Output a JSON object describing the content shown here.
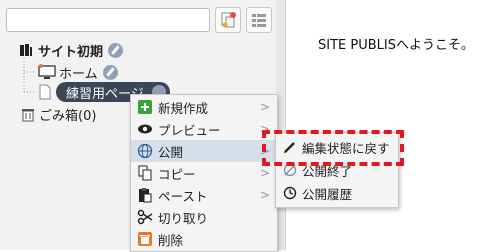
{
  "tree": {
    "site": "サイト初期",
    "home": "ホーム",
    "practice": "練習用ページ",
    "trash": "ごみ箱(0)"
  },
  "context_menu": {
    "items": [
      {
        "label": "新規作成",
        "has_submenu": true
      },
      {
        "label": "プレビュー",
        "has_submenu": true
      },
      {
        "label": "公開",
        "has_submenu": true
      },
      {
        "label": "コピー",
        "has_submenu": true
      },
      {
        "label": "ペースト",
        "has_submenu": true
      },
      {
        "label": "切り取り",
        "has_submenu": false
      },
      {
        "label": "削除",
        "has_submenu": false
      }
    ]
  },
  "submenu": {
    "items": [
      {
        "label": "編集状態に戻す"
      },
      {
        "label": "公開終了"
      },
      {
        "label": "公開履歴"
      }
    ]
  },
  "main": {
    "welcome": "SITE PUBLISへようこそ。"
  },
  "colors": {
    "highlight_box": "#e3181f",
    "selected_pill": "#3b4656",
    "menu_highlight": "#d6dfe9"
  }
}
